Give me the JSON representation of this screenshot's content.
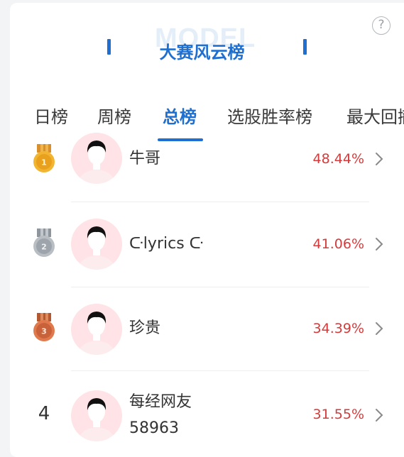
{
  "header": {
    "watermark": "MODEL",
    "title": "大赛风云榜",
    "help_symbol": "?"
  },
  "tabs": [
    {
      "label": "日榜",
      "active": false
    },
    {
      "label": "周榜",
      "active": false
    },
    {
      "label": "总榜",
      "active": true
    },
    {
      "label": "选股胜率榜",
      "active": false
    },
    {
      "label": "最大回撤",
      "active": false
    }
  ],
  "rows": [
    {
      "rank": "1",
      "medal": "gold-medal-icon",
      "name": "牛哥",
      "name2": "",
      "rate": "48.44%"
    },
    {
      "rank": "2",
      "medal": "silver-medal-icon",
      "name": "ᑢlyrics ᑢ",
      "name2": "",
      "rate": "41.06%"
    },
    {
      "rank": "3",
      "medal": "bronze-medal-icon",
      "name": "珍贵",
      "name2": "",
      "rate": "34.39%"
    },
    {
      "rank": "4",
      "medal": "",
      "name": "每经网友",
      "name2": "58963",
      "rate": "31.55%"
    }
  ],
  "colors": {
    "accent": "#1f6fd0",
    "rate": "#d63a3a",
    "avatar_bg": "#ffe3e6"
  }
}
